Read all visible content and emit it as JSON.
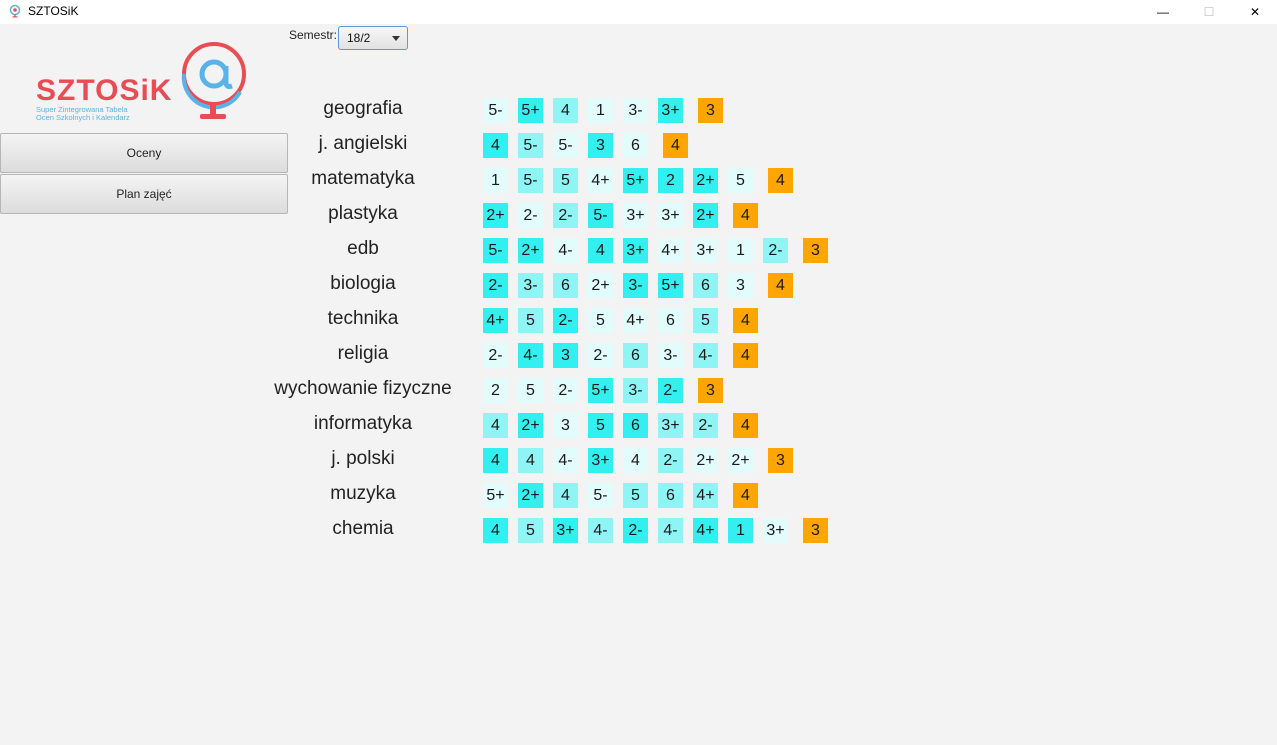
{
  "window": {
    "title": "SZTOSiK",
    "minimize_glyph": "—",
    "maximize_glyph": "☐",
    "close_glyph": "✕"
  },
  "logo": {
    "word": "SZTOSiK",
    "subtitle_line1": "Super Zintegrowana Tabela",
    "subtitle_line2": "Ocen Szkolnych i Kalendarz"
  },
  "nav": {
    "oceny": "Oceny",
    "plan": "Plan zajęć"
  },
  "semester": {
    "label": "Semestr:",
    "value": "18/2"
  },
  "colors": {
    "light": "#e2fbfb",
    "mid": "#8ef4f4",
    "dark": "#33f0f0",
    "final": "#ffa500"
  },
  "subjects": [
    {
      "name": "geografia",
      "grades": [
        [
          "5-",
          "light"
        ],
        [
          "5+",
          "dark"
        ],
        [
          "4",
          "mid"
        ],
        [
          "1",
          "light"
        ],
        [
          "3-",
          "light"
        ],
        [
          "3+",
          "dark"
        ]
      ],
      "final": "3"
    },
    {
      "name": "j. angielski",
      "grades": [
        [
          "4",
          "dark"
        ],
        [
          "5-",
          "mid"
        ],
        [
          "5-",
          "light"
        ],
        [
          "3",
          "dark"
        ],
        [
          "6",
          "light"
        ]
      ],
      "final": "4"
    },
    {
      "name": "matematyka",
      "grades": [
        [
          "1",
          "light"
        ],
        [
          "5-",
          "mid"
        ],
        [
          "5",
          "mid"
        ],
        [
          "4+",
          "light"
        ],
        [
          "5+",
          "dark"
        ],
        [
          "2",
          "dark"
        ],
        [
          "2+",
          "dark"
        ],
        [
          "5",
          "light"
        ]
      ],
      "final": "4"
    },
    {
      "name": "plastyka",
      "grades": [
        [
          "2+",
          "dark"
        ],
        [
          "2-",
          "light"
        ],
        [
          "2-",
          "mid"
        ],
        [
          "5-",
          "dark"
        ],
        [
          "3+",
          "light"
        ],
        [
          "3+",
          "light"
        ],
        [
          "2+",
          "dark"
        ]
      ],
      "final": "4"
    },
    {
      "name": "edb",
      "grades": [
        [
          "5-",
          "dark"
        ],
        [
          "2+",
          "dark"
        ],
        [
          "4-",
          "light"
        ],
        [
          "4",
          "dark"
        ],
        [
          "3+",
          "dark"
        ],
        [
          "4+",
          "light"
        ],
        [
          "3+",
          "light"
        ],
        [
          "1",
          "light"
        ],
        [
          "2-",
          "mid"
        ]
      ],
      "final": "3"
    },
    {
      "name": "biologia",
      "grades": [
        [
          "2-",
          "dark"
        ],
        [
          "3-",
          "mid"
        ],
        [
          "6",
          "mid"
        ],
        [
          "2+",
          "light"
        ],
        [
          "3-",
          "dark"
        ],
        [
          "5+",
          "dark"
        ],
        [
          "6",
          "mid"
        ],
        [
          "3",
          "light"
        ]
      ],
      "final": "4"
    },
    {
      "name": "technika",
      "grades": [
        [
          "4+",
          "dark"
        ],
        [
          "5",
          "mid"
        ],
        [
          "2-",
          "dark"
        ],
        [
          "5",
          "light"
        ],
        [
          "4+",
          "light"
        ],
        [
          "6",
          "light"
        ],
        [
          "5",
          "mid"
        ]
      ],
      "final": "4"
    },
    {
      "name": "religia",
      "grades": [
        [
          "2-",
          "light"
        ],
        [
          "4-",
          "dark"
        ],
        [
          "3",
          "dark"
        ],
        [
          "2-",
          "light"
        ],
        [
          "6",
          "mid"
        ],
        [
          "3-",
          "light"
        ],
        [
          "4-",
          "mid"
        ]
      ],
      "final": "4"
    },
    {
      "name": "wychowanie fizyczne",
      "grades": [
        [
          "2",
          "light"
        ],
        [
          "5",
          "light"
        ],
        [
          "2-",
          "light"
        ],
        [
          "5+",
          "dark"
        ],
        [
          "3-",
          "mid"
        ],
        [
          "2-",
          "dark"
        ]
      ],
      "final": "3"
    },
    {
      "name": "informatyka",
      "grades": [
        [
          "4",
          "mid"
        ],
        [
          "2+",
          "dark"
        ],
        [
          "3",
          "light"
        ],
        [
          "5",
          "dark"
        ],
        [
          "6",
          "dark"
        ],
        [
          "3+",
          "mid"
        ],
        [
          "2-",
          "mid"
        ]
      ],
      "final": "4"
    },
    {
      "name": "j. polski",
      "grades": [
        [
          "4",
          "dark"
        ],
        [
          "4",
          "mid"
        ],
        [
          "4-",
          "light"
        ],
        [
          "3+",
          "dark"
        ],
        [
          "4",
          "light"
        ],
        [
          "2-",
          "mid"
        ],
        [
          "2+",
          "light"
        ],
        [
          "2+",
          "light"
        ]
      ],
      "final": "3"
    },
    {
      "name": "muzyka",
      "grades": [
        [
          "5+",
          "light"
        ],
        [
          "2+",
          "dark"
        ],
        [
          "4",
          "mid"
        ],
        [
          "5-",
          "light"
        ],
        [
          "5",
          "mid"
        ],
        [
          "6",
          "mid"
        ],
        [
          "4+",
          "mid"
        ]
      ],
      "final": "4"
    },
    {
      "name": "chemia",
      "grades": [
        [
          "4",
          "dark"
        ],
        [
          "5",
          "mid"
        ],
        [
          "3+",
          "dark"
        ],
        [
          "4-",
          "mid"
        ],
        [
          "2-",
          "dark"
        ],
        [
          "4-",
          "mid"
        ],
        [
          "4+",
          "dark"
        ],
        [
          "1",
          "dark"
        ],
        [
          "3+",
          "light"
        ]
      ],
      "final": "3"
    }
  ]
}
